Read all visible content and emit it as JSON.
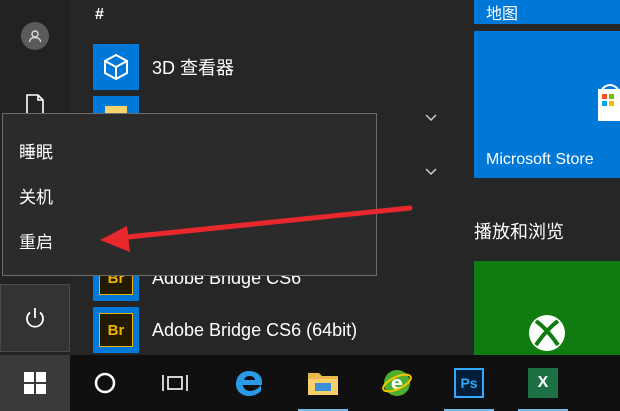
{
  "apps": {
    "section_header": "#",
    "items": [
      {
        "label": "3D 查看器",
        "icon": "cube-icon"
      },
      {
        "label": "",
        "icon": "folder-icon"
      },
      {
        "label": "Adobe Bridge CS6",
        "icon": "br-icon",
        "icon_text": "Br"
      },
      {
        "label": "Adobe Bridge CS6 (64bit)",
        "icon": "br-icon",
        "icon_text": "Br"
      }
    ]
  },
  "power_menu": {
    "items": [
      {
        "label": "睡眠"
      },
      {
        "label": "关机"
      },
      {
        "label": "重启"
      }
    ]
  },
  "tiles": {
    "maps_label": "地图",
    "store_label": "Microsoft Store",
    "group_title": "播放和浏览"
  },
  "taskbar": {
    "items": [
      "windows-logo-icon",
      "cortana-icon",
      "task-view-icon",
      "edge-icon",
      "file-explorer-icon",
      "green-e-browser-icon",
      "photoshop-icon",
      "excel-icon"
    ],
    "photoshop_text": "Ps",
    "excel_text": "X"
  },
  "colors": {
    "accent": "#0078d7",
    "xbox_green": "#107c10",
    "arrow_red": "#e8282c",
    "menu_bg": "#2b2b2b",
    "taskbar_bg": "#101010"
  }
}
